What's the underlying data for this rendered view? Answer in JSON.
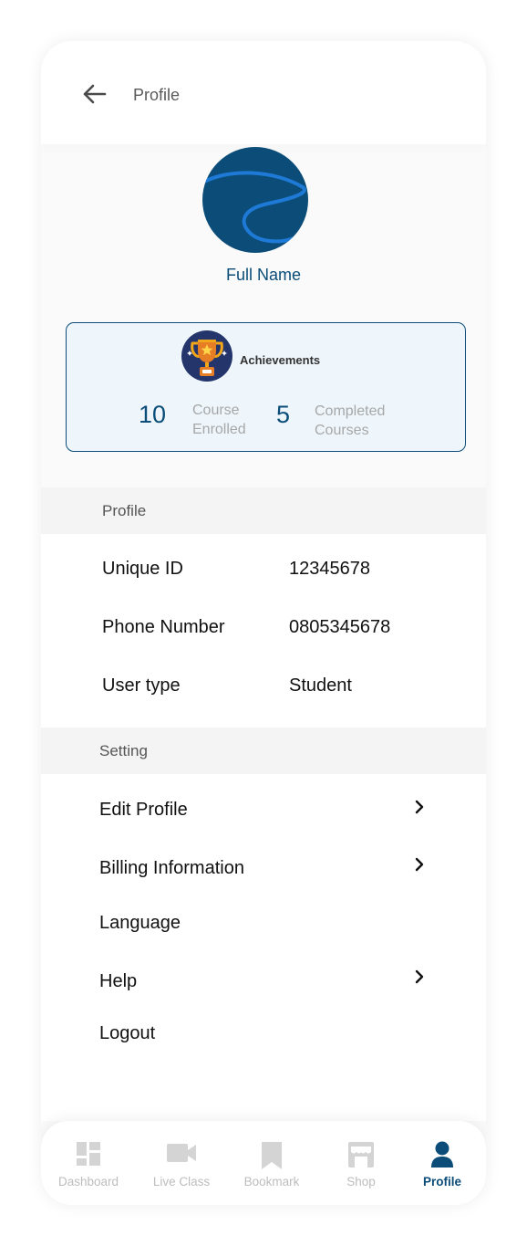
{
  "header": {
    "title": "Profile",
    "back_icon": "arrow-left-icon"
  },
  "profile": {
    "full_name": "Full Name",
    "avatar_icon": "avatar-icon"
  },
  "achievements": {
    "title": "Achievements",
    "icon": "trophy-icon",
    "stats": [
      {
        "value": "10",
        "label_line1": "Course",
        "label_line2": "Enrolled"
      },
      {
        "value": "5",
        "label_line1": "Completed",
        "label_line2": "Courses"
      }
    ]
  },
  "profile_section": {
    "heading": "Profile",
    "rows": [
      {
        "label": "Unique ID",
        "value": "12345678"
      },
      {
        "label": "Phone Number",
        "value": "0805345678"
      },
      {
        "label": "User type",
        "value": "Student"
      }
    ]
  },
  "settings_section": {
    "heading": "Setting",
    "items": [
      {
        "label": "Edit Profile",
        "has_chevron": true
      },
      {
        "label": "Billing Information",
        "has_chevron": true
      },
      {
        "label": "Language",
        "has_chevron": false
      },
      {
        "label": "Help",
        "has_chevron": true
      },
      {
        "label": "Logout",
        "has_chevron": false
      }
    ]
  },
  "bottom_nav": {
    "items": [
      {
        "label": "Dashboard",
        "icon": "dashboard-icon",
        "active": false
      },
      {
        "label": "Live Class",
        "icon": "video-camera-icon",
        "active": false
      },
      {
        "label": "Bookmark",
        "icon": "bookmark-icon",
        "active": false
      },
      {
        "label": "Shop",
        "icon": "shop-icon",
        "active": false
      },
      {
        "label": "Profile",
        "icon": "user-icon",
        "active": true
      }
    ]
  },
  "colors": {
    "primary": "#0b4d78",
    "accent_blue": "#1e7ad6",
    "inactive": "#d4d4d4",
    "card_bg": "#eef6fc"
  }
}
